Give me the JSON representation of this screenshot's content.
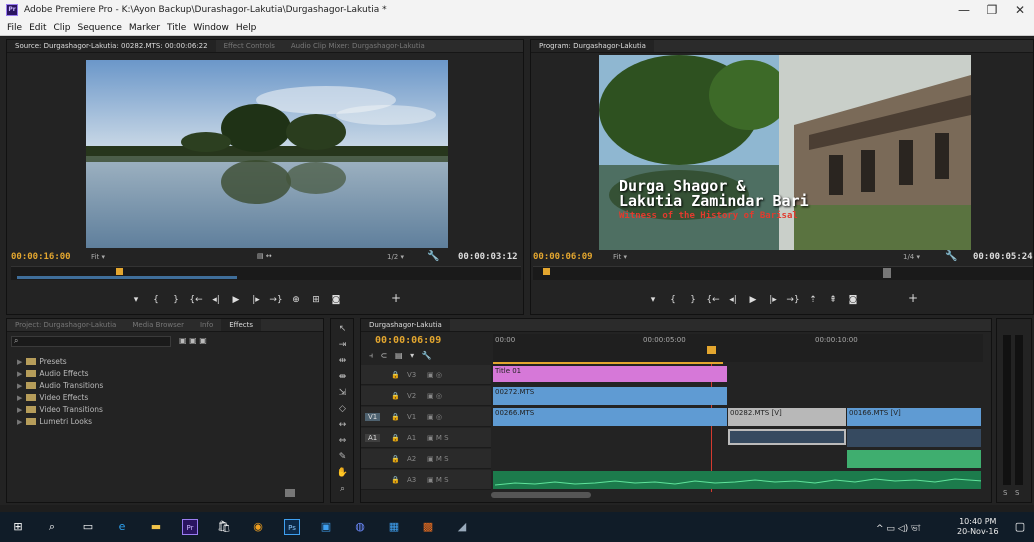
{
  "window": {
    "title": "Adobe Premiere Pro - K:\\Ayon Backup\\Durashagor-Lakutia\\Durgashagor-Lakutia *",
    "app_icon": "Pr",
    "controls": {
      "minimize": "—",
      "maximize": "❐",
      "close": "✕"
    }
  },
  "menu": [
    "File",
    "Edit",
    "Clip",
    "Sequence",
    "Marker",
    "Title",
    "Window",
    "Help"
  ],
  "source_panel": {
    "tabs": [
      "Source: Durgashagor-Lakutia: 00282.MTS: 00:00:06:22",
      "Effect Controls",
      "Audio Clip Mixer: Durgashagor-Lakutia"
    ],
    "timecode_in": "00:00:16:00",
    "fit": "Fit",
    "timecode_out": "00:00:03:12",
    "resolution": "1/2"
  },
  "program_panel": {
    "tab": "Program: Durgashagor-Lakutia",
    "title_line1": "Durga Shagor &",
    "title_line2": "Lakutia Zamindar Bari",
    "subtitle": "Witness of the History of Barisal",
    "timecode_in": "00:00:06:09",
    "fit": "Fit",
    "timecode_out": "00:00:05:24",
    "resolution": "1/4"
  },
  "project_panel": {
    "tabs": [
      "Project: Durgashagor-Lakutia",
      "Media Browser",
      "Info",
      "Effects"
    ],
    "search_placeholder": "",
    "items": [
      "Presets",
      "Audio Effects",
      "Audio Transitions",
      "Video Effects",
      "Video Transitions",
      "Lumetri Looks"
    ]
  },
  "timeline": {
    "tab": "Durgashagor-Lakutia",
    "timecode": "00:00:06:09",
    "ruler": [
      "00:00",
      "00:00:05:00",
      "00:00:10:00"
    ],
    "tracks": [
      {
        "name": "V3",
        "label": "V3"
      },
      {
        "name": "V2",
        "label": "V2"
      },
      {
        "name": "V1",
        "label": "V1",
        "target": "V1"
      },
      {
        "name": "A1",
        "label": "A1",
        "target": "A1"
      },
      {
        "name": "A2",
        "label": "A2"
      },
      {
        "name": "A3",
        "label": "A3"
      }
    ],
    "clips": {
      "v3": "Title 01",
      "v2": "00272.MTS",
      "v1a": "00266.MTS",
      "v1b": "00282.MTS [V]",
      "v1c": "00166.MTS [V]"
    },
    "track_toggles": {
      "mute": "M",
      "solo": "S"
    }
  },
  "audio_meter": {
    "labels": [
      "S",
      "S"
    ]
  },
  "taskbar": {
    "time": "10:40 PM",
    "date": "20-Nov-16",
    "lang": "ENG"
  }
}
